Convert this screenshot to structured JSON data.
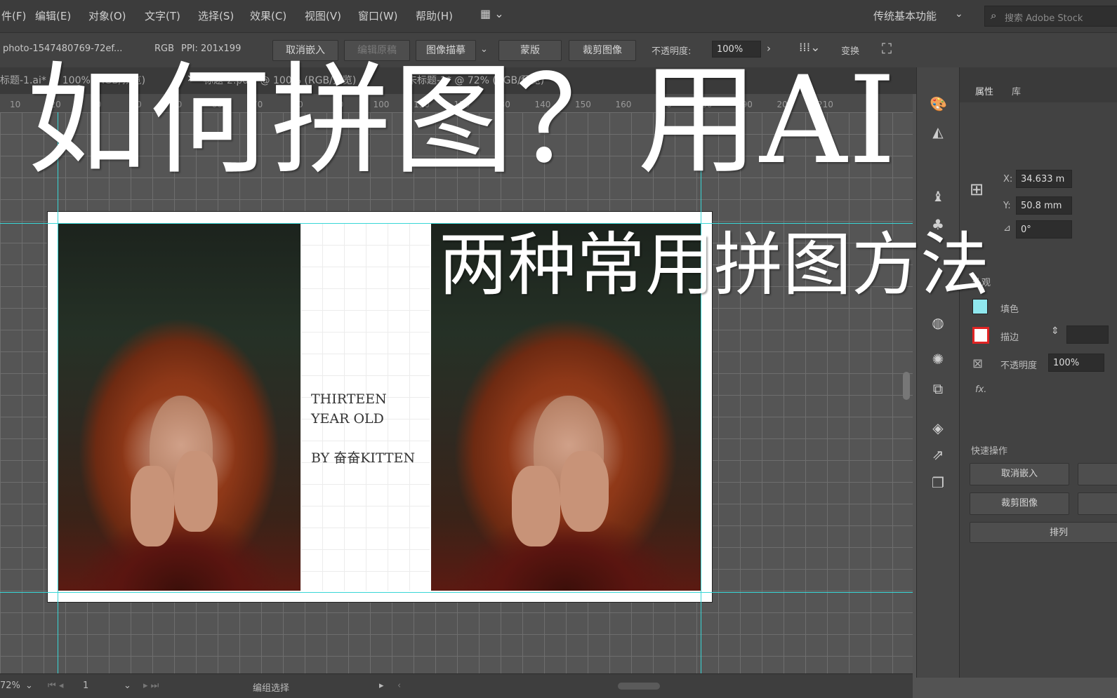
{
  "menu": {
    "items": [
      "件(F)",
      "编辑(E)",
      "对象(O)",
      "文字(T)",
      "选择(S)",
      "效果(C)",
      "视图(V)",
      "窗口(W)",
      "帮助(H)"
    ],
    "workspace": "传统基本功能",
    "search_placeholder": "搜索 Adobe Stock"
  },
  "control": {
    "filename": "photo-1547480769-72ef...",
    "color_mode": "RGB",
    "ppi": "PPI: 201x199",
    "unembed": "取消嵌入",
    "edit_original": "编辑原稿",
    "image_trace": "图像描摹",
    "mask": "蒙版",
    "crop_image": "裁剪图像",
    "opacity_label": "不透明度:",
    "opacity_value": "100%",
    "transform": "变换"
  },
  "tabs": [
    "标题-1.ai* @ 100% (RGB/预览)",
    "标题-2.pdf* @ 100% (RGB/预览)",
    "未标题-1* @ 72% (RGB/预览)"
  ],
  "ruler": [
    "10",
    "20",
    "30",
    "40",
    "50",
    "60",
    "70",
    "80",
    "90",
    "100",
    "110",
    "120",
    "130",
    "140",
    "150",
    "160",
    "170",
    "180",
    "190",
    "200",
    "210"
  ],
  "overlay": {
    "title": "如何拼图？用AI",
    "subtitle": "两种常用拼图方法"
  },
  "artboard_text": {
    "line1": "THIRTEEN",
    "line2": "YEAR OLD",
    "line3": "BY 奋奋KITTEN"
  },
  "panel": {
    "tabs": [
      "属性",
      "库"
    ],
    "x_label": "X:",
    "x_value": "34.633 m",
    "y_label": "Y:",
    "y_value": "50.8 mm",
    "angle_value": "0°",
    "appearance_header": "外观",
    "fill_label": "填色",
    "stroke_label": "描边",
    "opacity_label": "不透明度",
    "opacity_value": "100%",
    "fx_label": "fx.",
    "quick_actions_header": "快速操作",
    "btn_unembed": "取消嵌入",
    "btn_crop": "裁剪图像",
    "btn_arrange": "排列"
  },
  "status": {
    "zoom": "72%",
    "page": "1",
    "mode": "编组选择"
  },
  "colors": {
    "guide": "#38d6d6",
    "fill_swatch": "#8fe7ee",
    "stroke_swatch": "#e02424"
  }
}
